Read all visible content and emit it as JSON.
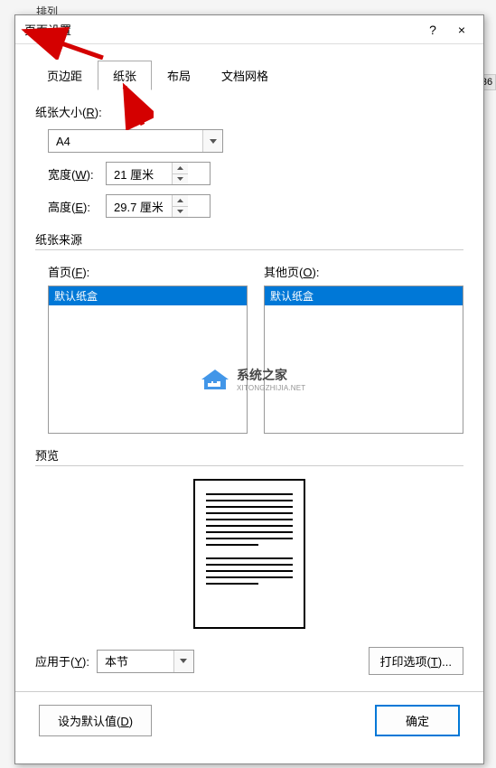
{
  "bg": {
    "ribbon": "排列",
    "side": "36"
  },
  "dialog": {
    "title": "页面设置",
    "help": "?",
    "close": "×"
  },
  "tabs": {
    "items": [
      {
        "label": "页边距"
      },
      {
        "label": "纸张"
      },
      {
        "label": "布局"
      },
      {
        "label": "文档网格"
      }
    ],
    "active": 1
  },
  "paper_size": {
    "label": "纸张大小",
    "hotkey": "R",
    "value": "A4",
    "width_label": "宽度",
    "width_hotkey": "W",
    "width_value": "21 厘米",
    "height_label": "高度",
    "height_hotkey": "E",
    "height_value": "29.7 厘米"
  },
  "paper_source": {
    "label": "纸张来源",
    "first_page_label": "首页",
    "first_page_hotkey": "F",
    "other_pages_label": "其他页",
    "other_pages_hotkey": "O",
    "first_page_items": [
      "默认纸盒"
    ],
    "other_pages_items": [
      "默认纸盒"
    ]
  },
  "preview": {
    "label": "预览"
  },
  "apply_to": {
    "label": "应用于",
    "hotkey": "Y",
    "value": "本节"
  },
  "print_options": {
    "label": "打印选项",
    "hotkey": "T"
  },
  "footer": {
    "default": "设为默认值",
    "default_hotkey": "D",
    "ok": "确定"
  },
  "watermark": {
    "line1": "系统之家",
    "line2": "XITONGZHIJIA.NET"
  }
}
